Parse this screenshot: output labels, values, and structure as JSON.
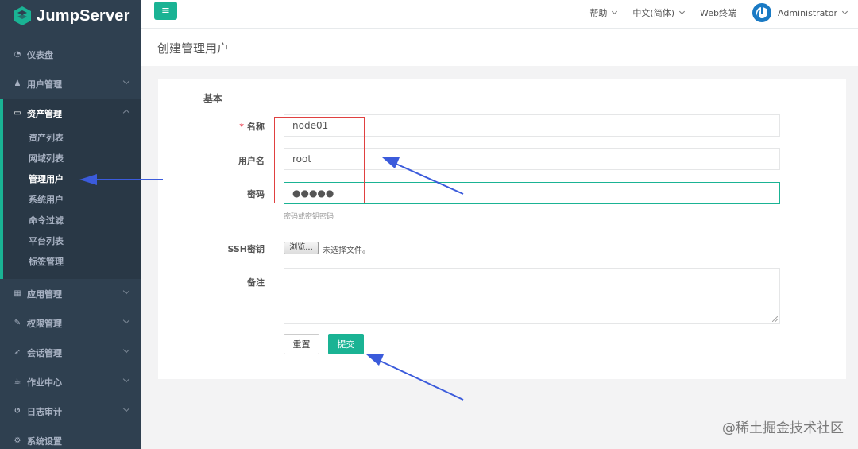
{
  "app": {
    "name": "JumpServer"
  },
  "topbar": {
    "menu_icon": "≡",
    "help": "帮助",
    "language": "中文(简体)",
    "web_terminal": "Web终端",
    "user": "Administrator"
  },
  "sidebar": {
    "items": [
      {
        "label": "仪表盘",
        "icon": "dashboard-icon"
      },
      {
        "label": "用户管理",
        "icon": "users-icon"
      },
      {
        "label": "资产管理",
        "icon": "inbox-icon",
        "expanded": true,
        "children": [
          "资产列表",
          "网域列表",
          "管理用户",
          "系统用户",
          "命令过滤",
          "平台列表",
          "标签管理"
        ],
        "active_child": "管理用户"
      },
      {
        "label": "应用管理",
        "icon": "grid-icon"
      },
      {
        "label": "权限管理",
        "icon": "edit-icon"
      },
      {
        "label": "会话管理",
        "icon": "rocket-icon"
      },
      {
        "label": "作业中心",
        "icon": "coffee-icon"
      },
      {
        "label": "日志审计",
        "icon": "history-icon"
      },
      {
        "label": "系统设置",
        "icon": "gears-icon"
      }
    ]
  },
  "page": {
    "title": "创建管理用户"
  },
  "form": {
    "section": "基本",
    "name_label": "名称",
    "required_mark": "*",
    "name_value": "node01",
    "username_label": "用户名",
    "username_value": "root",
    "password_label": "密码",
    "password_value": "●●●●●",
    "password_help": "密码或密钥密码",
    "ssh_label": "SSH密钥",
    "browse_label": "浏览...",
    "no_file": "未选择文件。",
    "comment_label": "备注",
    "reset_label": "重置",
    "submit_label": "提交"
  },
  "watermark": "@稀土掘金技术社区",
  "colors": {
    "accent": "#1ab394",
    "sidebar": "#2f4050",
    "annotation_red": "#e04040",
    "annotation_arrow": "#3b5bdb"
  }
}
